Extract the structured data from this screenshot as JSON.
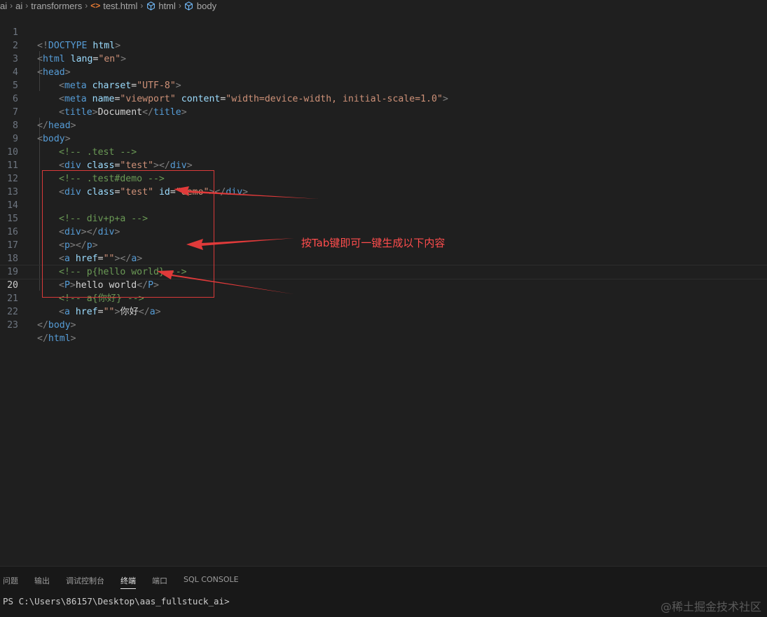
{
  "breadcrumb": {
    "items": [
      "ai",
      "ai",
      "transformers",
      "test.html",
      "html",
      "body"
    ]
  },
  "editor": {
    "line_numbers": [
      "1",
      "2",
      "3",
      "4",
      "5",
      "6",
      "7",
      "8",
      "9",
      "10",
      "11",
      "12",
      "13",
      "14",
      "15",
      "16",
      "17",
      "18",
      "19",
      "20",
      "21",
      "22",
      "23"
    ],
    "active_line": "20",
    "lines": {
      "l1": {
        "open": "<!",
        "doctype": "DOCTYPE",
        "sp": " ",
        "html": "html",
        "close": ">"
      },
      "l2": {
        "lt": "<",
        "tag": "html",
        "sp": " ",
        "attr": "lang",
        "eq": "=",
        "val": "\"en\"",
        "gt": ">"
      },
      "l3": {
        "lt": "<",
        "tag": "head",
        "gt": ">"
      },
      "l4": {
        "lt": "<",
        "tag": "meta",
        "sp": " ",
        "attr": "charset",
        "eq": "=",
        "val": "\"UTF-8\"",
        "gt": ">"
      },
      "l5": {
        "lt": "<",
        "tag": "meta",
        "sp": " ",
        "attr1": "name",
        "eq1": "=",
        "val1": "\"viewport\"",
        "sp2": " ",
        "attr2": "content",
        "eq2": "=",
        "val2": "\"width=device-width, initial-scale=1.0\"",
        "gt": ">"
      },
      "l6": {
        "lt": "<",
        "tag": "title",
        "gt": ">",
        "text": "Document",
        "lt2": "</",
        "tag2": "title",
        "gt2": ">"
      },
      "l7": {
        "lt": "</",
        "tag": "head",
        "gt": ">"
      },
      "l8": {
        "lt": "<",
        "tag": "body",
        "gt": ">"
      },
      "l9": {
        "comment": "<!-- .test -->"
      },
      "l10": {
        "lt": "<",
        "tag": "div",
        "sp": " ",
        "attr": "class",
        "eq": "=",
        "val": "\"test\"",
        "gt": ">",
        "lt2": "</",
        "tag2": "div",
        "gt2": ">"
      },
      "l11": {
        "comment": "<!-- .test#demo -->"
      },
      "l12": {
        "lt": "<",
        "tag": "div",
        "sp": " ",
        "attr1": "class",
        "eq1": "=",
        "val1": "\"test\"",
        "sp2": " ",
        "attr2": "id",
        "eq2": "=",
        "val2": "\"demo\"",
        "gt": ">",
        "lt2": "</",
        "tag2": "div",
        "gt2": ">"
      },
      "l14": {
        "comment": "<!-- div+p+a -->"
      },
      "l15": {
        "lt": "<",
        "tag": "div",
        "gt": ">",
        "lt2": "</",
        "tag2": "div",
        "gt2": ">"
      },
      "l16": {
        "lt": "<",
        "tag": "p",
        "gt": ">",
        "lt2": "</",
        "tag2": "p",
        "gt2": ">"
      },
      "l17": {
        "lt": "<",
        "tag": "a",
        "sp": " ",
        "attr": "href",
        "eq": "=",
        "val": "\"\"",
        "gt": ">",
        "lt2": "</",
        "tag2": "a",
        "gt2": ">"
      },
      "l18": {
        "comment": "<!-- p{hello world} -->"
      },
      "l19": {
        "lt": "<",
        "tag": "P",
        "gt": ">",
        "text": "hello world",
        "lt2": "</",
        "tag2": "P",
        "gt2": ">"
      },
      "l20": {
        "comment_a": "<!-- a{",
        "comment_cjk": "你好",
        "comment_b": "} -->"
      },
      "l21": {
        "lt": "<",
        "tag": "a",
        "sp": " ",
        "attr": "href",
        "eq": "=",
        "val": "\"\"",
        "gt": ">",
        "text": "你好",
        "lt2": "</",
        "tag2": "a",
        "gt2": ">"
      },
      "l22": {
        "lt": "</",
        "tag": "body",
        "gt": ">"
      },
      "l23": {
        "lt": "</",
        "tag": "html",
        "gt": ">"
      }
    }
  },
  "annotation": {
    "text": "按Tab键即可一键生成以下内容",
    "color": "#ff4d4d"
  },
  "panel": {
    "tabs": [
      "问题",
      "输出",
      "调试控制台",
      "终端",
      "端口",
      "SQL CONSOLE"
    ],
    "active_tab": "终端",
    "terminal_prompt": "PS C:\\Users\\86157\\Desktop\\aas_fullstuck_ai>"
  },
  "watermark": "@稀土掘金技术社区",
  "colors": {
    "background": "#1f1f1f",
    "tag": "#569cd6",
    "attribute": "#9cdcfe",
    "string": "#ce9178",
    "comment": "#6a9955",
    "annotation": "#d93a3a"
  }
}
